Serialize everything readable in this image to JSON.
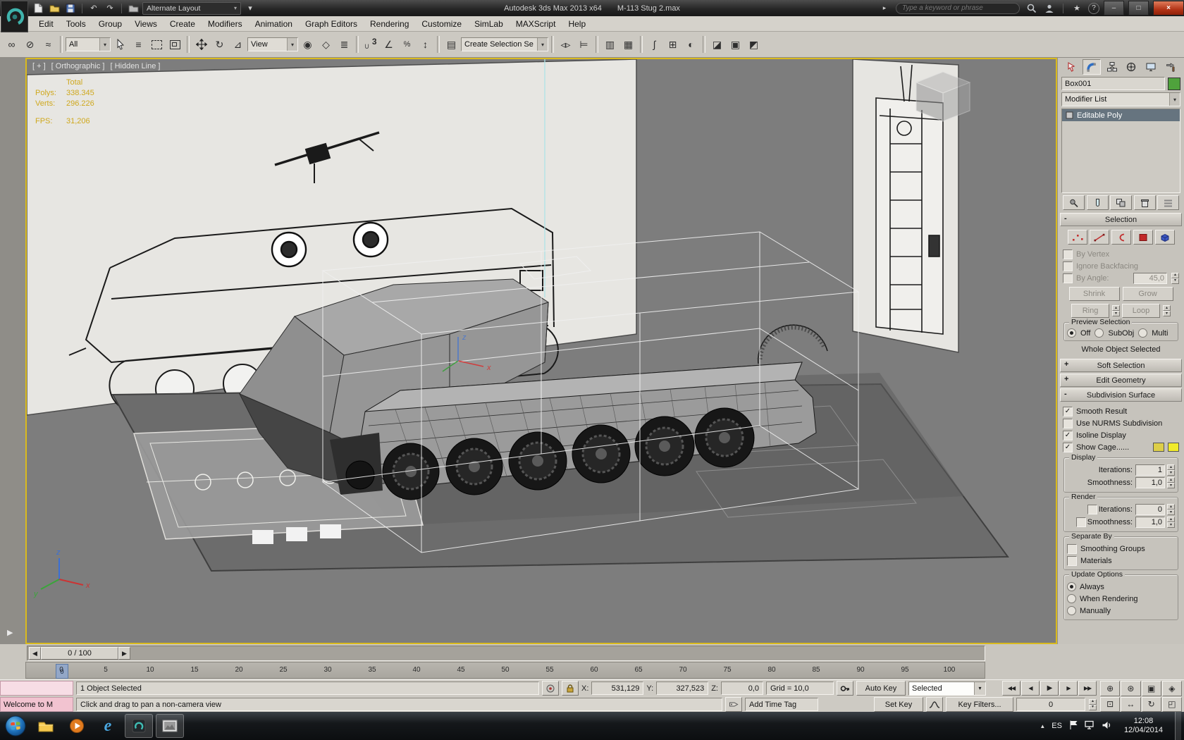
{
  "titlebar": {
    "workspace": "Alternate Layout",
    "app_title": "Autodesk 3ds Max 2013 x64",
    "doc_title": "M-113 Stug 2.max",
    "search_placeholder": "Type a keyword or phrase"
  },
  "menus": [
    "Edit",
    "Tools",
    "Group",
    "Views",
    "Create",
    "Modifiers",
    "Animation",
    "Graph Editors",
    "Rendering",
    "Customize",
    "SimLab",
    "MAXScript",
    "Help"
  ],
  "toolbar": {
    "filter": "All",
    "coord": "View",
    "named_sel": "Create Selection Se",
    "snap3": "3"
  },
  "viewport": {
    "label_plus": "[ + ]",
    "label_view": "[ Orthographic ]",
    "label_shading": "[ Hidden Line ]",
    "axis_x": "x",
    "axis_y": "y",
    "axis_z": "z",
    "stats": {
      "total": "Total",
      "polys_label": "Polys:",
      "polys_value": "338.345",
      "verts_label": "Verts:",
      "verts_value": "296.226",
      "fps_label": "FPS:",
      "fps_value": "31,206"
    }
  },
  "panel": {
    "object_name": "Box001",
    "modifier_list": "Modifier List",
    "stack_item": "Editable Poly",
    "selection": {
      "title": "Selection",
      "by_vertex": "By Vertex",
      "ignore_backfacing": "Ignore Backfacing",
      "by_angle": "By Angle:",
      "by_angle_value": "45,0",
      "shrink": "Shrink",
      "grow": "Grow",
      "ring": "Ring",
      "loop": "Loop",
      "preview_title": "Preview Selection",
      "off": "Off",
      "subobj": "SubObj",
      "multi": "Multi",
      "whole": "Whole Object Selected"
    },
    "soft_selection": "Soft Selection",
    "edit_geometry": "Edit Geometry",
    "subdiv": {
      "title": "Subdivision Surface",
      "smooth_result": "Smooth Result",
      "use_nurms": "Use NURMS Subdivision",
      "isoline": "Isoline Display",
      "show_cage": "Show Cage......",
      "display_title": "Display",
      "render_title": "Render",
      "iterations_label": "Iterations:",
      "smoothness_label": "Smoothness:",
      "display_iterations": "1",
      "display_smoothness": "1,0",
      "render_iterations": "0",
      "render_smoothness": "1,0",
      "separate_title": "Separate By",
      "smoothing_groups": "Smoothing Groups",
      "materials": "Materials",
      "update_title": "Update Options",
      "always": "Always",
      "when_rendering": "When Rendering",
      "manually": "Manually"
    }
  },
  "timeline": {
    "slider_value": "0 / 100",
    "marker": "0",
    "ticks": [
      "0",
      "5",
      "10",
      "15",
      "20",
      "25",
      "30",
      "35",
      "40",
      "45",
      "50",
      "55",
      "60",
      "65",
      "70",
      "75",
      "80",
      "85",
      "90",
      "95",
      "100"
    ]
  },
  "status": {
    "selection_info": "1 Object Selected",
    "prompt": "Click and drag to pan a non-camera view",
    "x_label": "X:",
    "x_value": "531,129",
    "y_label": "Y:",
    "y_value": "327,523",
    "z_label": "Z:",
    "z_value": "0,0",
    "grid_value": "Grid = 10,0",
    "add_time_tag": "Add Time Tag",
    "auto_key": "Auto Key",
    "set_key": "Set Key",
    "key_mode": "Selected",
    "key_filters": "Key Filters...",
    "frame_value": "0",
    "mini_listener": "Welcome to M"
  },
  "taskbar": {
    "lang": "ES",
    "time": "12:08",
    "date": "12/04/2014"
  },
  "icons": {
    "undo": "↶",
    "redo": "↷",
    "link": "∞",
    "unlink": "⊘",
    "bind": "≈",
    "by_name": "≡",
    "rotate": "↻",
    "scale": "⊿",
    "pivot": "◉",
    "manipulate": "◇",
    "kbd": "≣",
    "angle": "∠",
    "percent": "%",
    "spinner_snap": "↕",
    "named_sets": "▤",
    "mirror": "◃▹",
    "align": "⊨",
    "layers": "▥",
    "ribbon": "▦",
    "curve_editor": "∫",
    "schematic": "⊞",
    "material": "◐",
    "render_setup": "◪",
    "frame_window": "▣",
    "render": "◩",
    "collapse": "▸",
    "star": "★",
    "help": "?",
    "min": "–",
    "max": "□",
    "close": "×",
    "dd": "▾",
    "spin_up": "▴",
    "spin_down": "▾",
    "plus": "+",
    "minus": "-",
    "check": "✓",
    "slider_prev": "◀",
    "slider_next": "▶",
    "go_start": "◀◀",
    "prev_frame": "◀",
    "play": "▶",
    "next_frame": "▶",
    "go_end": "▶▶",
    "zoom": "⊕",
    "zoom_all": "⊛",
    "zoom_ext": "▣",
    "zoom_ext_all": "◈",
    "zoom_region": "⊡",
    "pan": "↔",
    "orbit": "↻",
    "maximize": "◰",
    "tray_up": "▲",
    "strip_arrow": "▶"
  }
}
